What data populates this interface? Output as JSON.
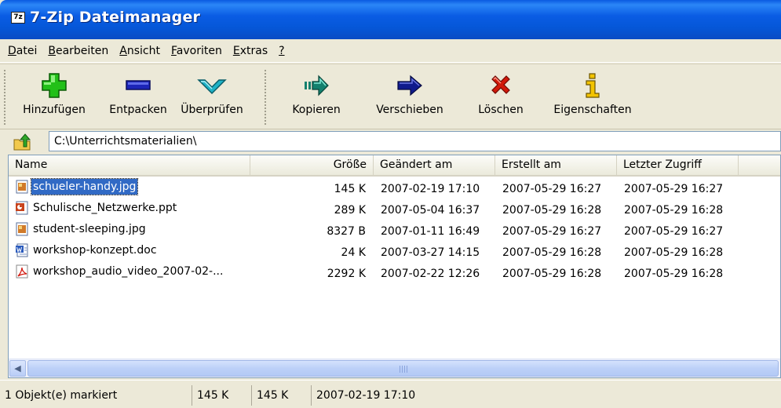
{
  "window": {
    "title": "7-Zip Dateimanager",
    "icon_text": "7z"
  },
  "menu": [
    {
      "label": "Datei",
      "key": "D",
      "rest": "atei"
    },
    {
      "label": "Bearbeiten",
      "key": "B",
      "rest": "earbeiten"
    },
    {
      "label": "Ansicht",
      "key": "A",
      "rest": "nsicht"
    },
    {
      "label": "Favoriten",
      "key": "F",
      "rest": "avoriten"
    },
    {
      "label": "Extras",
      "key": "E",
      "rest": "xtras"
    },
    {
      "label": "?",
      "key": "?",
      "rest": ""
    }
  ],
  "toolbar": {
    "add_label": "Hinzufügen",
    "extract_label": "Entpacken",
    "test_label": "Überprüfen",
    "copy_label": "Kopieren",
    "move_label": "Verschieben",
    "delete_label": "Löschen",
    "properties_label": "Eigenschaften",
    "icons": {
      "add": "plus-icon",
      "extract": "minus-icon",
      "test": "check-icon",
      "copy": "copy-arrow-icon",
      "move": "move-arrow-icon",
      "delete": "delete-x-icon",
      "properties": "info-icon"
    },
    "colors": {
      "add": "#22c018",
      "extract": "#1c25b8",
      "test": "#1aa6b8",
      "copy": "#13806e",
      "move": "#0f1a8c",
      "delete": "#d11a0a",
      "properties": "#c29b00"
    }
  },
  "address": {
    "path": "C:\\Unterrichtsmaterialien\\"
  },
  "columns": {
    "name": "Name",
    "size": "Größe",
    "modified": "Geändert am",
    "created": "Erstellt am",
    "accessed": "Letzter Zugriff"
  },
  "files": [
    {
      "name": "schueler-handy.jpg",
      "size": "145 K",
      "modified": "2007-02-19 17:10",
      "created": "2007-05-29 16:27",
      "accessed": "2007-05-29 16:27",
      "icon": "image-file-icon",
      "selected": true
    },
    {
      "name": "Schulische_Netzwerke.ppt",
      "size": "289 K",
      "modified": "2007-05-04 16:37",
      "created": "2007-05-29 16:28",
      "accessed": "2007-05-29 16:28",
      "icon": "powerpoint-file-icon",
      "selected": false
    },
    {
      "name": "student-sleeping.jpg",
      "size": "8327 B",
      "modified": "2007-01-11 16:49",
      "created": "2007-05-29 16:27",
      "accessed": "2007-05-29 16:27",
      "icon": "image-file-icon",
      "selected": false
    },
    {
      "name": "workshop-konzept.doc",
      "size": "24 K",
      "modified": "2007-03-27 14:15",
      "created": "2007-05-29 16:28",
      "accessed": "2007-05-29 16:28",
      "icon": "word-file-icon",
      "selected": false
    },
    {
      "name": "workshop_audio_video_2007-02-...",
      "size": "2292 K",
      "modified": "2007-02-22 12:26",
      "created": "2007-05-29 16:28",
      "accessed": "2007-05-29 16:28",
      "icon": "pdf-file-icon",
      "selected": false
    }
  ],
  "status": {
    "selection": "1 Objekt(e) markiert",
    "selected_size": "145 K",
    "total_size": "145 K",
    "date": "2007-02-19 17:10"
  }
}
